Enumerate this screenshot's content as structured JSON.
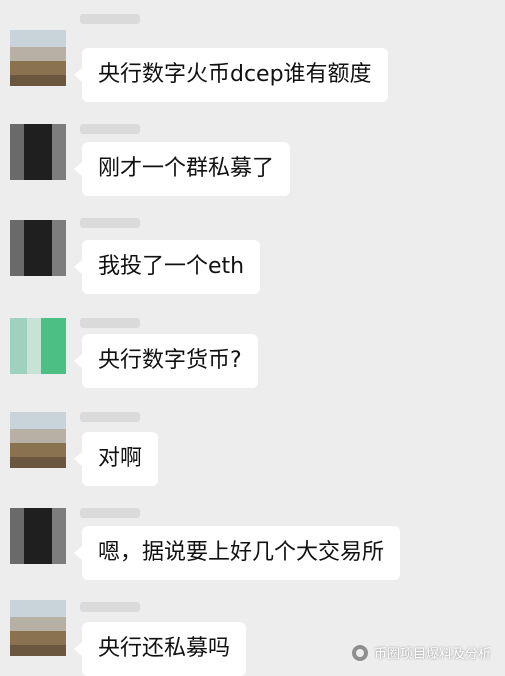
{
  "messages": [
    {
      "text": "央行数字火币dcep谁有额度",
      "avatar": "pixelated-avatar-light"
    },
    {
      "text": "刚才一个群私募了",
      "avatar": "pixelated-avatar-dark"
    },
    {
      "text": "我投了一个eth",
      "avatar": "pixelated-avatar-dark"
    },
    {
      "text": "央行数字货币?",
      "avatar": "pixelated-avatar-green"
    },
    {
      "text": "对啊",
      "avatar": "pixelated-avatar-light"
    },
    {
      "text": "嗯，据说要上好几个大交易所",
      "avatar": "pixelated-avatar-dark"
    },
    {
      "text": "央行还私募吗",
      "avatar": "pixelated-avatar-light"
    }
  ],
  "watermark": {
    "text": "币圈项目爆料及分析"
  },
  "colors": {
    "background": "#ededed",
    "bubble": "#ffffff",
    "text": "#111111"
  }
}
